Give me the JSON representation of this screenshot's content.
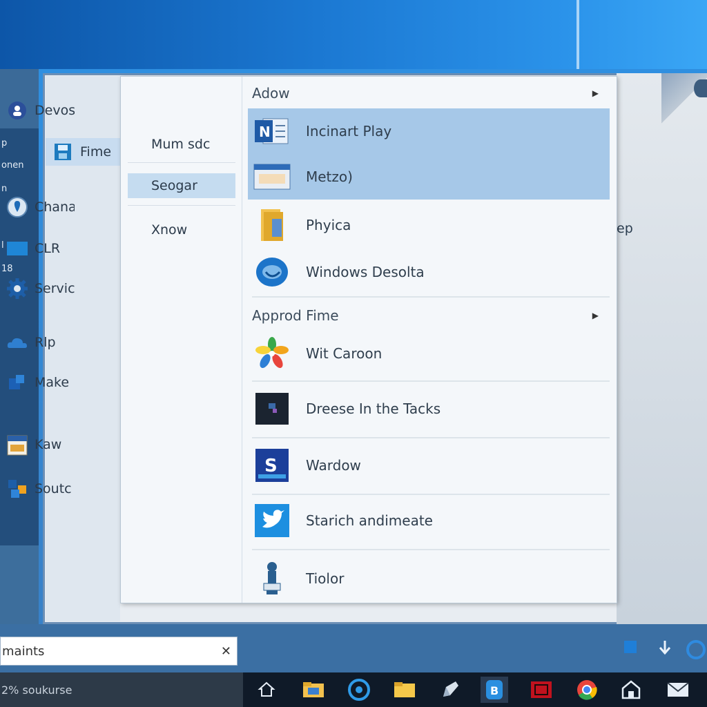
{
  "left_panel": {
    "lines": [
      "p",
      "onen",
      "n",
      "l",
      "18"
    ]
  },
  "nav": {
    "items": [
      {
        "label": "Devos",
        "icon": "user-circle-icon"
      },
      {
        "label": "Fime",
        "icon": "save-icon"
      },
      {
        "label": "Chana",
        "icon": "location-pin-icon"
      },
      {
        "label": "CLR",
        "icon": "display-icon"
      },
      {
        "label": "Servic",
        "icon": "gear-icon"
      },
      {
        "label": "Rlp",
        "icon": "cloud-icon"
      },
      {
        "label": "Make",
        "icon": "puzzle-icon"
      },
      {
        "label": "Kaw",
        "icon": "calendar-icon"
      },
      {
        "label": "Soutc",
        "icon": "apps-icon"
      }
    ]
  },
  "submenu": {
    "items": [
      "Mum sdc",
      "Seogar",
      "Xnow"
    ],
    "selected_index": 1
  },
  "menu": {
    "section1_title": "Adow",
    "section2_title": "Approd Fime",
    "section1_entries": [
      {
        "label": "Incinart Play",
        "icon": "notes-app-icon",
        "highlighted": true
      },
      {
        "label": "Metzo)",
        "icon": "window-app-icon",
        "highlighted": true
      },
      {
        "label": "Phyica",
        "icon": "folder-icon",
        "highlighted": false
      },
      {
        "label": "Windows Desolta",
        "icon": "globe-app-icon",
        "highlighted": false
      }
    ],
    "section2_entries": [
      {
        "label": "Wit Caroon",
        "icon": "pinwheel-icon"
      },
      {
        "label": "Dreese In the Tacks",
        "icon": "terminal-icon"
      },
      {
        "label": "Wardow",
        "icon": "s-app-icon"
      },
      {
        "label": "Starich andimeate",
        "icon": "bird-app-icon"
      },
      {
        "label": "Tiolor",
        "icon": "figure-icon"
      }
    ]
  },
  "right_side_text": "ep",
  "search": {
    "value": "maints",
    "clear_glyph": "✕"
  },
  "taskbar": {
    "left_text": "2% soukurse",
    "icons": [
      "home-icon",
      "file-explorer-icon",
      "browser-icon",
      "folder-icon",
      "pen-icon",
      "settings-app-icon",
      "media-app-icon",
      "chrome-icon",
      "store-icon",
      "mail-icon"
    ]
  },
  "colors": {
    "highlight": "#a6c8e8",
    "taskbar": "#0f1a28",
    "accent": "#1e7fd6"
  }
}
